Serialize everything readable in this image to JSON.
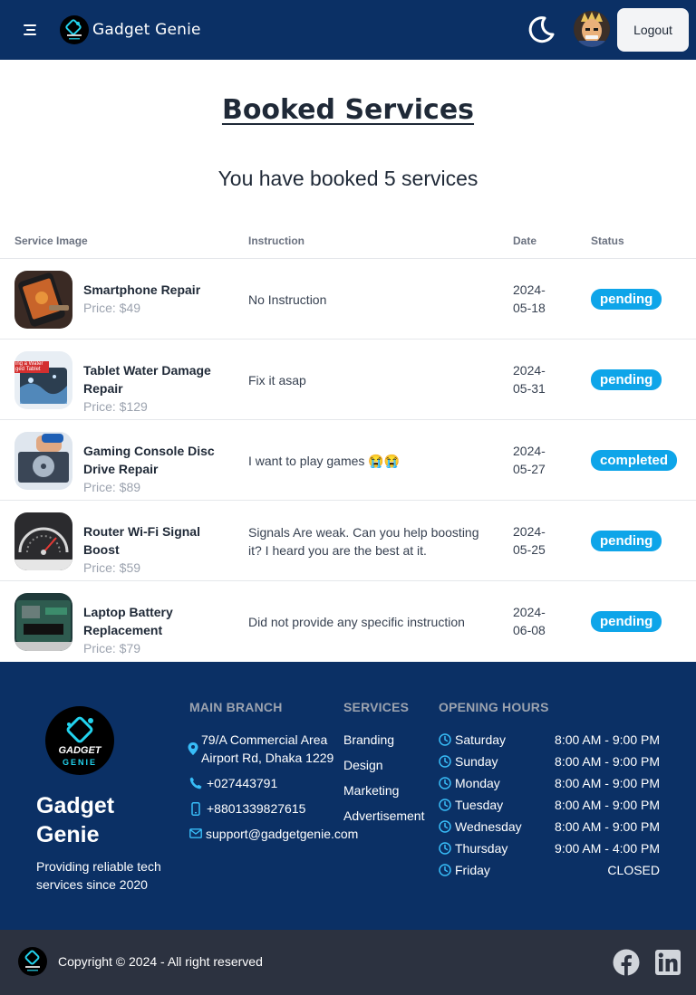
{
  "header": {
    "brand": "Gadget Genie",
    "logout_label": "Logout"
  },
  "main": {
    "title": "Booked Services",
    "subtitle": "You have booked 5 services",
    "columns": [
      "Service Image",
      "Instruction",
      "Date",
      "Status"
    ],
    "bookings": [
      {
        "name": "Smartphone Repair",
        "price": "Price: $49",
        "instruction": "No Instruction",
        "date": "2024-05-18",
        "date_line1": "2024-",
        "date_line2": "05-18",
        "status": "pending"
      },
      {
        "name": "Tablet Water Damage Repair",
        "price": "Price: $129",
        "instruction": "Fix it asap",
        "date": "2024-05-31",
        "date_line1": "2024-",
        "date_line2": "05-31",
        "status": "pending"
      },
      {
        "name": "Gaming Console Disc Drive Repair",
        "price": "Price: $89",
        "instruction": "I want to play games 😭😭",
        "date": "2024-05-27",
        "date_line1": "2024-",
        "date_line2": "05-27",
        "status": "completed"
      },
      {
        "name": "Router Wi-Fi Signal Boost",
        "price": "Price: $59",
        "instruction": "Signals Are weak. Can you help boosting it? I heard you are the best at it.",
        "date": "2024-05-25",
        "date_line1": "2024-",
        "date_line2": "05-25",
        "status": "pending"
      },
      {
        "name": "Laptop Battery Replacement",
        "price": "Price: $79",
        "instruction": "Did not provide any specific instruction",
        "date": "2024-06-08",
        "date_line1": "2024-",
        "date_line2": "06-08",
        "status": "pending"
      }
    ],
    "thumb_overlay_text": "ing a Water\nged Tablet"
  },
  "footer": {
    "logo_text_top": "GADGET",
    "logo_text_bottom": "GENIE",
    "brand": "Gadget Genie",
    "tagline": "Providing reliable tech services since 2020",
    "branch": {
      "heading": "MAIN BRANCH",
      "address_line1": "79/A Commercial Area",
      "address_line2": "Airport Rd, Dhaka 1229",
      "phone": "+027443791",
      "mobile": "+8801339827615",
      "email": "support@gadgetgenie.com"
    },
    "services": {
      "heading": "SERVICES",
      "items": [
        "Branding",
        "Design",
        "Marketing",
        "Advertisement"
      ]
    },
    "hours": {
      "heading": "OPENING HOURS",
      "days": [
        {
          "day": "Saturday",
          "time": "8:00 AM - 9:00 PM"
        },
        {
          "day": "Sunday",
          "time": "8:00 AM - 9:00 PM"
        },
        {
          "day": "Monday",
          "time": "8:00 AM - 9:00 PM"
        },
        {
          "day": "Tuesday",
          "time": "8:00 AM - 9:00 PM"
        },
        {
          "day": "Wednesday",
          "time": "8:00 AM - 9:00 PM"
        },
        {
          "day": "Thursday",
          "time": "9:00 AM - 4:00 PM"
        },
        {
          "day": "Friday",
          "time": "CLOSED"
        }
      ]
    },
    "copyright": "Copyright © 2024 - All right reserved",
    "social": [
      "facebook-icon",
      "linkedin-icon"
    ]
  },
  "colors": {
    "navy": "#0b3065",
    "status_badge": "#0ea5e9",
    "footer_bottom": "#2c3240",
    "accent_cyan": "#38bdf8"
  }
}
